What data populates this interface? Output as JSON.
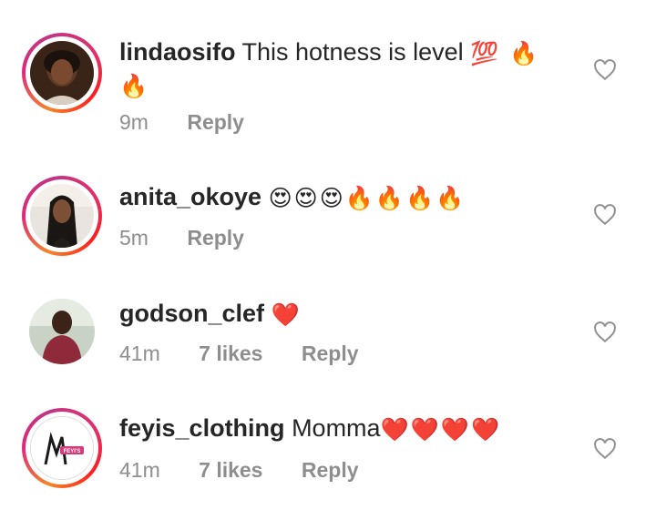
{
  "comments": [
    {
      "username": "lindaosifo",
      "text": "This hotness is level",
      "emojis_line1": "💯 🔥",
      "emojis_line2": "🔥",
      "time": "9m",
      "likes": "",
      "reply": "Reply"
    },
    {
      "username": "anita_okoye",
      "text": "",
      "emojis_line1": "😍😍😍🔥🔥🔥🔥",
      "time": "5m",
      "likes": "",
      "reply": "Reply"
    },
    {
      "username": "godson_clef",
      "text": "",
      "emojis_line1": "❤️",
      "time": "41m",
      "likes": "7 likes",
      "reply": "Reply"
    },
    {
      "username": "feyis_clothing",
      "text": "Momma",
      "emojis_line1": "❤️❤️❤️❤️",
      "time": "41m",
      "likes": "7 likes",
      "reply": "Reply",
      "avatar_logo_text": "FEYI'S"
    }
  ],
  "icons": {
    "like": "heart-outline-icon",
    "ring_colors": [
      "#f58529",
      "#dd2a7b",
      "#c13584"
    ]
  }
}
